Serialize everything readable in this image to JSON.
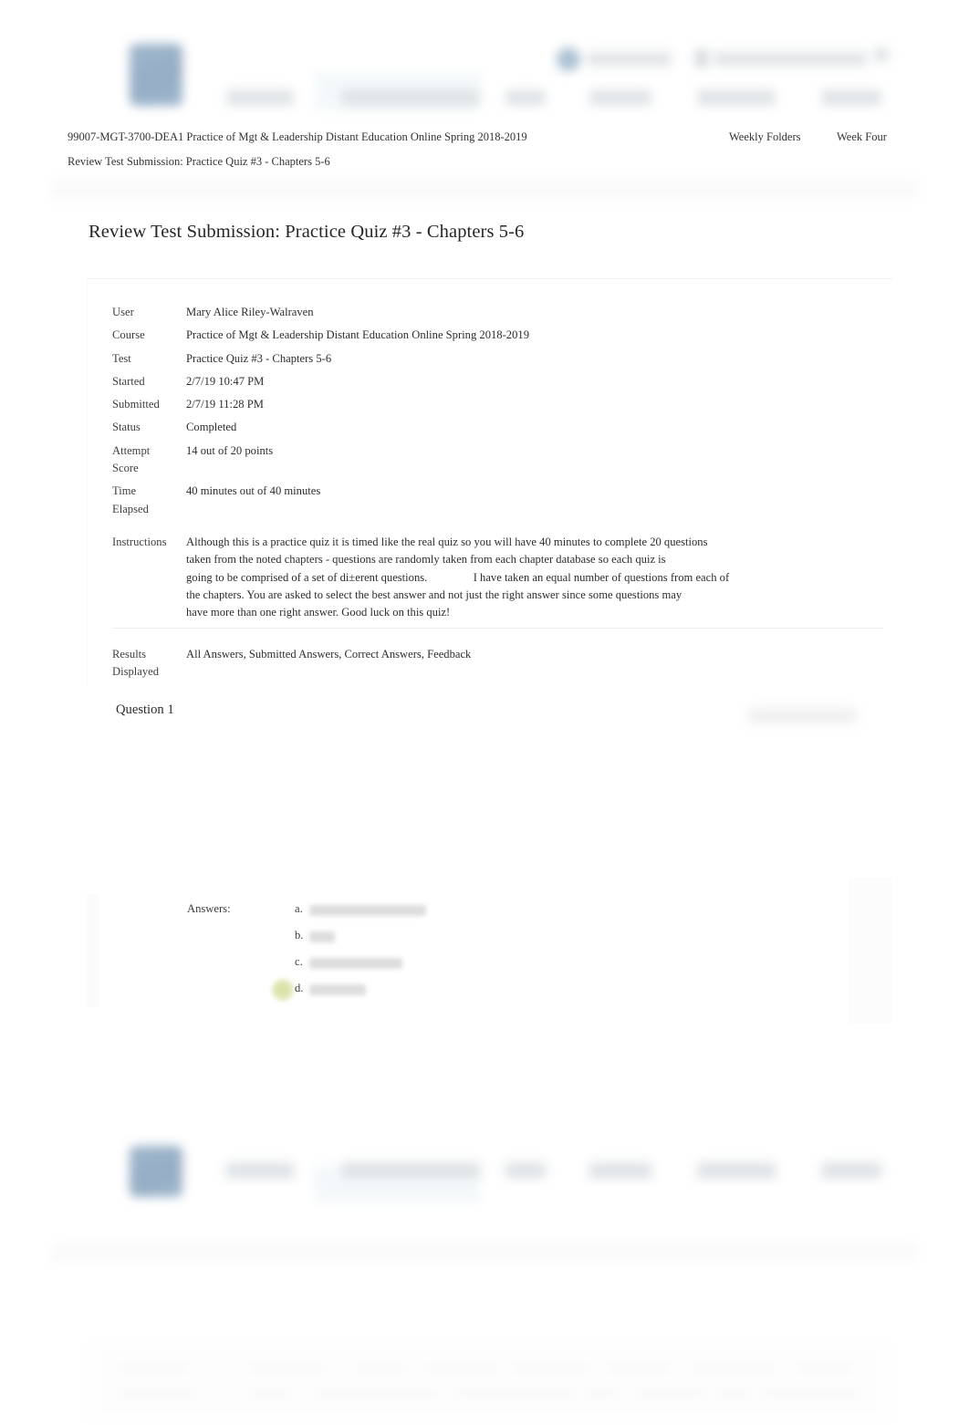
{
  "page": {
    "title": "Review Test Submission: Practice Quiz #3 - Chapters 5-6",
    "breadcrumb_course": "99007-MGT-3700-DEA1 Practice of Mgt & Leadership Distant Education Online Spring 2018-2019",
    "breadcrumb_weekly_folders": "Weekly Folders",
    "breadcrumb_week_four": "Week Four",
    "breadcrumb_current": "Review Test Submission: Practice Quiz #3 - Chapters 5-6"
  },
  "navbar": {
    "logo_name": "institution-logo",
    "search_placeholder": "",
    "items": [
      {
        "label": "",
        "name": "nav-item-1"
      },
      {
        "label": "",
        "name": "nav-item-2"
      },
      {
        "label": "",
        "name": "nav-item-3"
      },
      {
        "label": "",
        "name": "nav-item-4"
      },
      {
        "label": "",
        "name": "nav-item-5"
      },
      {
        "label": "",
        "name": "nav-item-6"
      }
    ]
  },
  "info": {
    "rows": [
      {
        "key": "User",
        "value": "Mary Alice Riley-Walraven"
      },
      {
        "key": "Course",
        "value": "Practice of Mgt & Leadership Distant Education Online Spring 2018-2019"
      },
      {
        "key": "Test",
        "value": "Practice Quiz #3 - Chapters 5-6"
      },
      {
        "key": "Started",
        "value": "2/7/19 10:47 PM"
      },
      {
        "key": "Submitted",
        "value": "2/7/19 11:28 PM"
      },
      {
        "key": "Status",
        "value": "Completed"
      },
      {
        "key": "Attempt\nScore",
        "value": "14 out of 20 points"
      },
      {
        "key": "Time\nElapsed",
        "value": "40 minutes out of 40 minutes"
      }
    ],
    "attempt_score_key_line1": "Attempt",
    "attempt_score_key_line2": "Score",
    "attempt_score_value": "14 out of 20 points",
    "time_elapsed_key_line1": "Time",
    "time_elapsed_key_line2": "Elapsed",
    "time_elapsed_value": "40 minutes out of 40 minutes",
    "instructions_key": "Instructions",
    "instructions_lines": [
      "Although this is a practice quiz it is timed like the real quiz so you will have 40 minutes to complete 20 questions",
      "taken from the noted chapters - questions are randomly taken from each chapter database so each quiz is",
      "going to be comprised of a set of di±erent questions.                I have taken an equal number of questions from each of",
      "the chapters. You are asked to select the best answer and not just the right answer since some questions may",
      "have more than one right answer. Good luck on this quiz!"
    ],
    "results_displayed_key_line1": "Results",
    "results_displayed_key_line2": "Displayed",
    "results_displayed_value": "All Answers, Submitted Answers, Correct Answers, Feedback"
  },
  "question": {
    "heading": "Question 1",
    "points_redacted": true,
    "text_redacted": true
  },
  "answers": {
    "label": "Answers:",
    "options": [
      {
        "letter": "a.",
        "text_redacted": true,
        "selected": false
      },
      {
        "letter": "b.",
        "text_redacted": true,
        "selected": false
      },
      {
        "letter": "c.",
        "text_redacted": true,
        "selected": false
      },
      {
        "letter": "d.",
        "text_redacted": true,
        "selected": true
      }
    ]
  },
  "colors": {
    "logo_blue": "#3a6a9a",
    "avatar_blue": "#5d87ab",
    "search_bg": "#e9f3f7",
    "correct_marker": "#d7de9c",
    "band_grey": "#f4f4f5",
    "text": "#2d2d2d"
  }
}
